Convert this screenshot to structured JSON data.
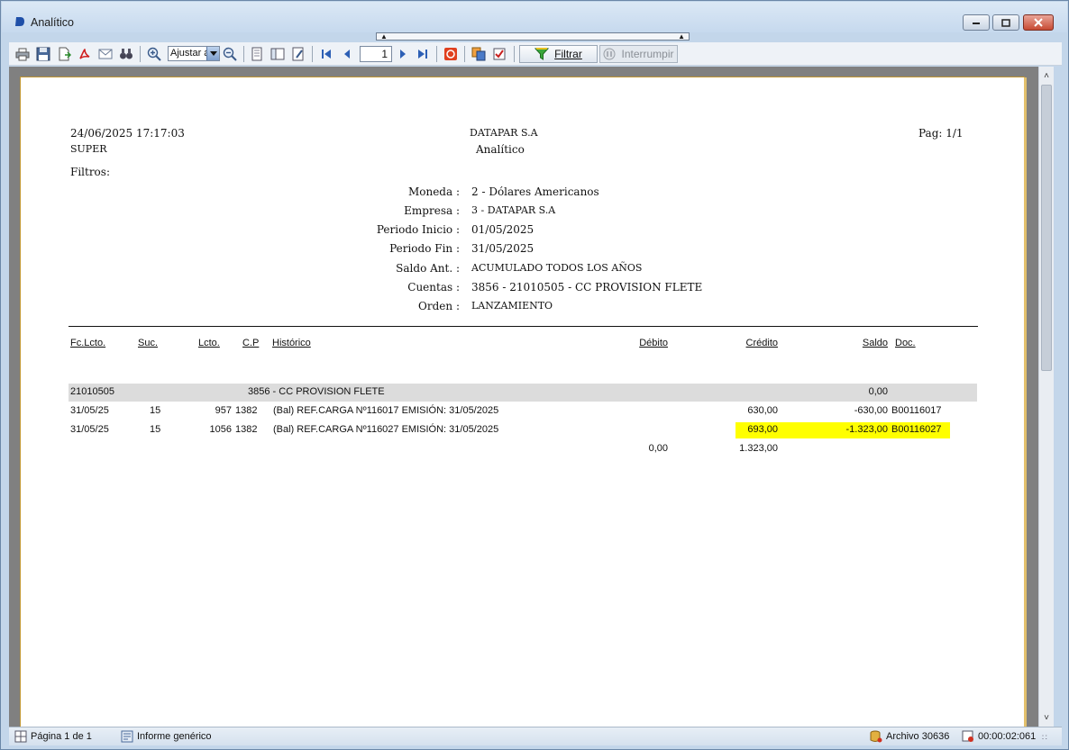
{
  "window": {
    "title": "Analítico"
  },
  "toolbar": {
    "zoom_value": "Ajustar a",
    "page_value": "1",
    "filter_label": "Filtrar",
    "stop_label": "Interrumpir"
  },
  "report": {
    "datetime": "24/06/2025 17:17:03",
    "user": "SUPER",
    "company": "DATAPAR S.A",
    "report_name": "Analítico",
    "page_label": "Pag: 1/1",
    "filters_label": "Filtros:",
    "filters": [
      {
        "label": "Moneda :",
        "value": "2 - Dólares Americanos"
      },
      {
        "label": "Empresa :",
        "value": "3 - DATAPAR S.A"
      },
      {
        "label": "Periodo Inicio :",
        "value": "01/05/2025"
      },
      {
        "label": "Periodo Fin :",
        "value": "31/05/2025"
      },
      {
        "label": "Saldo Ant. :",
        "value": "ACUMULADO TODOS LOS AÑOS"
      },
      {
        "label": "Cuentas :",
        "value": "3856 - 21010505 - CC PROVISION FLETE"
      },
      {
        "label": "Orden :",
        "value": "LANZAMIENTO"
      }
    ],
    "columns": {
      "fc_lcto": "Fc.Lcto.",
      "suc": "Suc.",
      "lcto": "Lcto.",
      "cp": "C.P",
      "historico": "Histórico",
      "debito": "Débito",
      "credito": "Crédito",
      "saldo": "Saldo",
      "doc": "Doc."
    },
    "account": {
      "code": "21010505",
      "name": "3856 - CC PROVISION FLETE",
      "saldo": "0,00"
    },
    "rows": [
      {
        "fecha": "31/05/25",
        "suc": "15",
        "lcto": "957",
        "cp": "1382",
        "historico": "(Bal) REF.CARGA Nº116017 EMISIÓN: 31/05/2025",
        "debito": "",
        "credito": "630,00",
        "saldo": "-630,00",
        "doc": "B00116017"
      },
      {
        "fecha": "31/05/25",
        "suc": "15",
        "lcto": "1056",
        "cp": "1382",
        "historico": "(Bal) REF.CARGA Nº116027 EMISIÓN: 31/05/2025",
        "debito": "",
        "credito": "693,00",
        "saldo": "-1.323,00",
        "doc": "B00116027"
      }
    ],
    "totals": {
      "debito": "0,00",
      "credito": "1.323,00"
    }
  },
  "statusbar": {
    "page_text": "Página 1 de 1",
    "report_type": "Informe genérico",
    "archive": "Archivo 30636",
    "elapsed": "00:00:02:061"
  },
  "colors": {
    "highlight": "#ffff00",
    "band": "#dcdcdc",
    "page_border": "#c19632"
  }
}
